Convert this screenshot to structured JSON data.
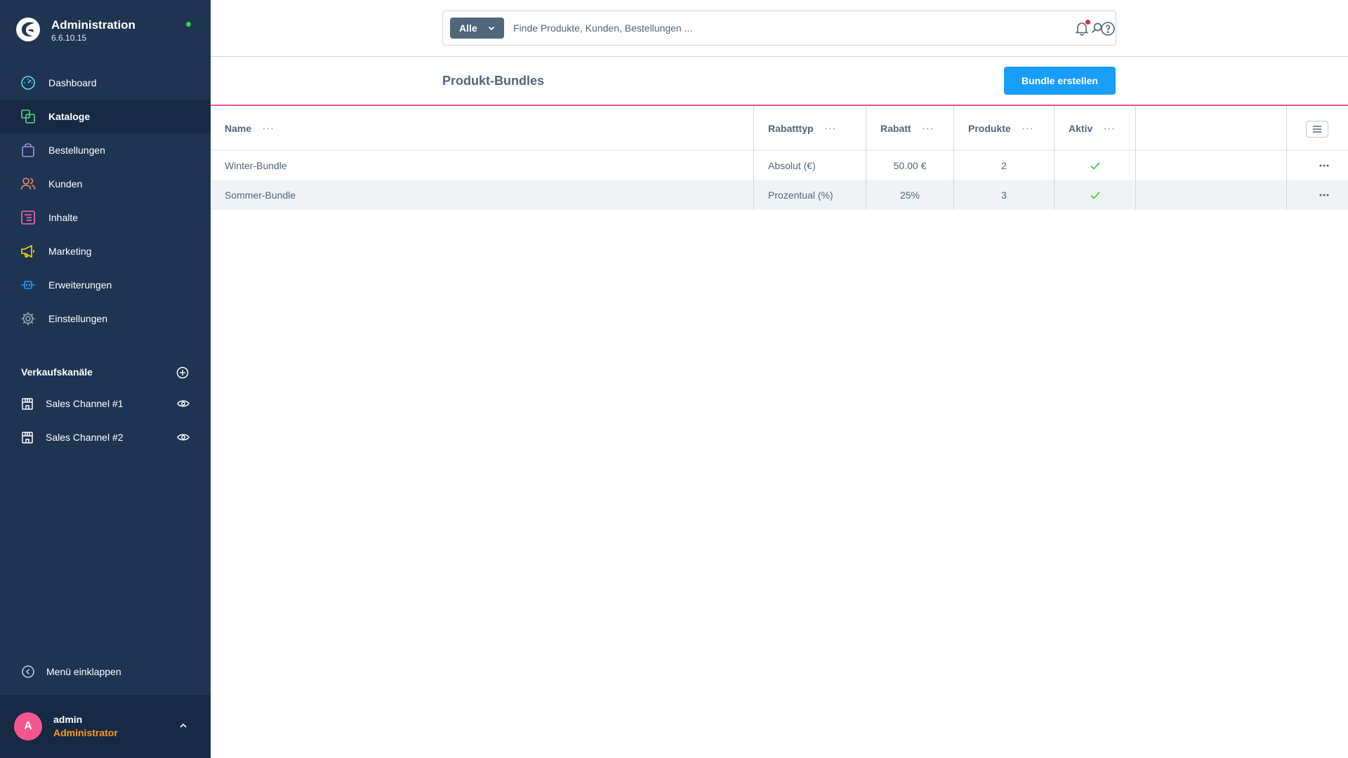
{
  "app": {
    "title": "Administration",
    "version": "6.6.10.15"
  },
  "nav": {
    "items": [
      {
        "label": "Dashboard",
        "icon": "gauge-icon",
        "color": "#57d9ff"
      },
      {
        "label": "Kataloge",
        "icon": "catalog-icon",
        "color": "#57d97c",
        "active": true
      },
      {
        "label": "Bestellungen",
        "icon": "bag-icon",
        "color": "#a092f0"
      },
      {
        "label": "Kunden",
        "icon": "users-icon",
        "color": "#f88962"
      },
      {
        "label": "Inhalte",
        "icon": "content-icon",
        "color": "#ff68b4"
      },
      {
        "label": "Marketing",
        "icon": "megaphone-icon",
        "color": "#ffd700"
      },
      {
        "label": "Erweiterungen",
        "icon": "plug-icon",
        "color": "#189eff"
      },
      {
        "label": "Einstellungen",
        "icon": "gear-icon",
        "color": "#9aa8b5"
      }
    ]
  },
  "sales_channels": {
    "title": "Verkaufskanäle",
    "items": [
      {
        "label": "Sales Channel #1"
      },
      {
        "label": "Sales Channel #2"
      }
    ]
  },
  "collapse_label": "Menü einklappen",
  "user": {
    "initial": "A",
    "name": "admin",
    "role": "Administrator"
  },
  "search": {
    "type_label": "Alle",
    "placeholder": "Finde Produkte, Kunden, Bestellungen ..."
  },
  "page": {
    "title": "Produkt-Bundles",
    "create_label": "Bundle erstellen"
  },
  "grid": {
    "columns": [
      "Name",
      "Rabatttyp",
      "Rabatt",
      "Produkte",
      "Aktiv"
    ],
    "rows": [
      {
        "name": "Winter-Bundle",
        "discount_type": "Absolut (€)",
        "discount": "50.00 €",
        "products": "2",
        "active": true
      },
      {
        "name": "Sommer-Bundle",
        "discount_type": "Prozentual (%)",
        "discount": "25%",
        "products": "3",
        "active": true
      }
    ]
  },
  "colors": {
    "sidebar": "#1f3451",
    "accent": "#189eff",
    "active_check": "#37d046",
    "page_border": "#f9568f"
  }
}
